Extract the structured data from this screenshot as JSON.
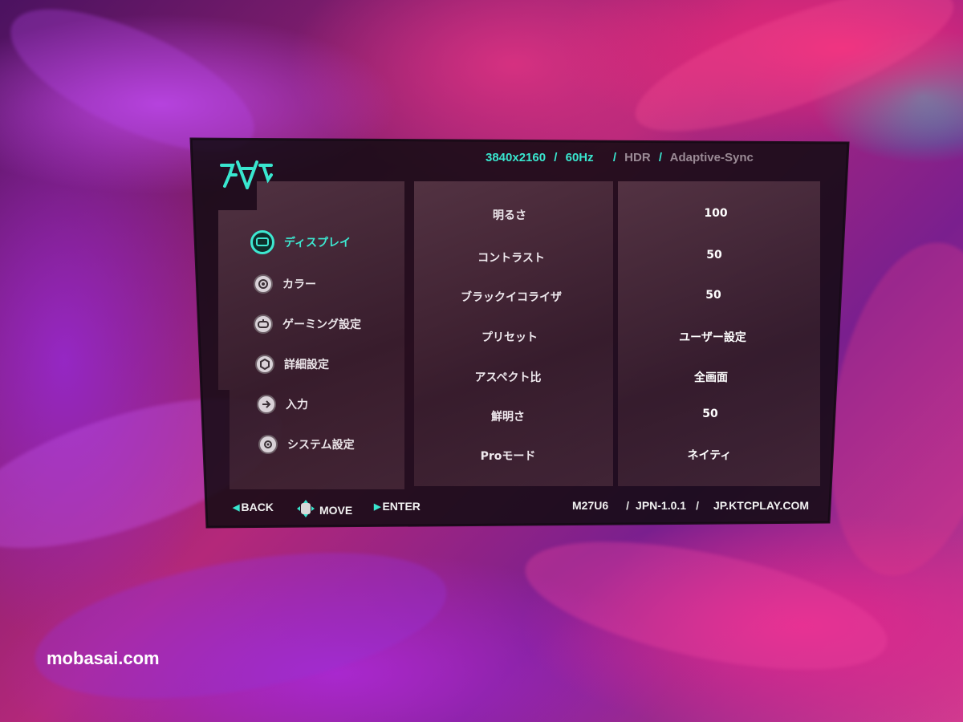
{
  "header": {
    "resolution": "3840x2160",
    "refresh_rate": "60Hz",
    "hdr": "HDR",
    "sync": "Adaptive-Sync",
    "separator": "/"
  },
  "menu": {
    "items": [
      {
        "label": "ディスプレイ",
        "icon": "display-icon",
        "active": true
      },
      {
        "label": "カラー",
        "icon": "color-icon",
        "active": false
      },
      {
        "label": "ゲーミング設定",
        "icon": "gaming-icon",
        "active": false
      },
      {
        "label": "詳細設定",
        "icon": "advanced-settings-icon",
        "active": false
      },
      {
        "label": "入力",
        "icon": "input-icon",
        "active": false
      },
      {
        "label": "システム設定",
        "icon": "system-settings-icon",
        "active": false
      }
    ]
  },
  "settings": [
    {
      "label": "明るさ",
      "value": "100"
    },
    {
      "label": "コントラスト",
      "value": "50"
    },
    {
      "label": "ブラックイコライザ",
      "value": "50"
    },
    {
      "label": "プリセット",
      "value": "ユーザー設定"
    },
    {
      "label": "アスペクト比",
      "value": "全画面"
    },
    {
      "label": "鮮明さ",
      "value": "50"
    },
    {
      "label": "Proモード",
      "value": "ネイティ"
    }
  ],
  "footer": {
    "back": "BACK",
    "move": "MOVE",
    "enter": "ENTER",
    "model": "M27U6",
    "firmware": "JPN-1.0.1",
    "website": "JP.KTCPLAY.COM"
  },
  "watermark": "mobasai.com",
  "colors": {
    "accent": "#39e6cf",
    "text": "#efe9ee",
    "osd_background": "#100a10"
  }
}
